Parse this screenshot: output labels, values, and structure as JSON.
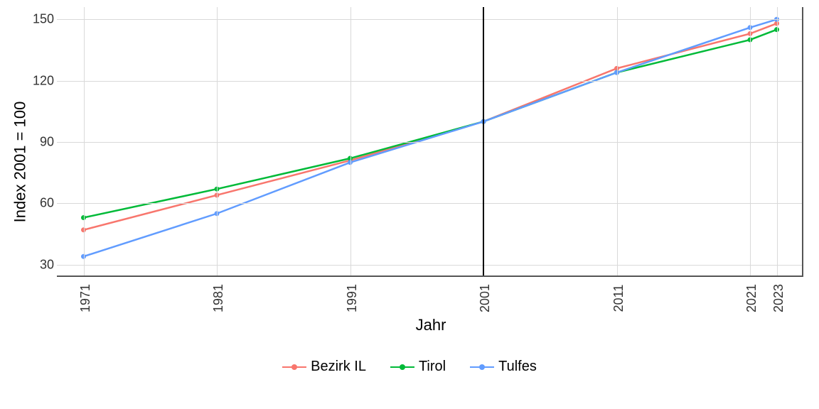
{
  "chart_data": {
    "type": "line",
    "xlabel": "Jahr",
    "ylabel": "Index 2001 = 100",
    "x": [
      1971,
      1981,
      1991,
      2001,
      2011,
      2021,
      2023
    ],
    "xticks": [
      1971,
      1981,
      1991,
      2001,
      2011,
      2021,
      2023
    ],
    "yticks": [
      30,
      60,
      90,
      120,
      150
    ],
    "ylim": [
      24,
      156
    ],
    "xlim": [
      1969,
      2025
    ],
    "refline_x": 2001,
    "series": [
      {
        "name": "Bezirk IL",
        "color": "#F8766D",
        "values": [
          47,
          64,
          81,
          100,
          126,
          143,
          148
        ]
      },
      {
        "name": "Tirol",
        "color": "#00BA38",
        "values": [
          53,
          67,
          82,
          100,
          124,
          140,
          145
        ]
      },
      {
        "name": "Tulfes",
        "color": "#619CFF",
        "values": [
          34,
          55,
          80,
          100,
          124,
          146,
          150
        ]
      }
    ]
  }
}
